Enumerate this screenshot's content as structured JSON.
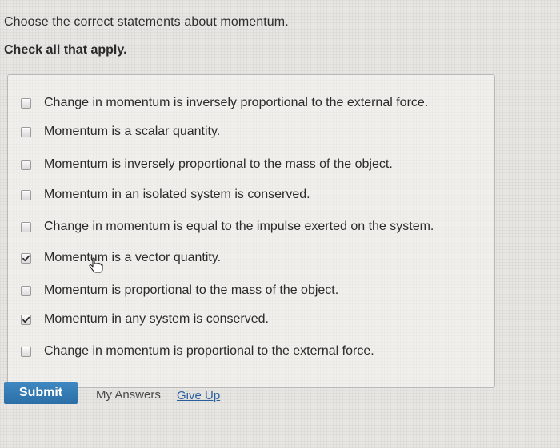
{
  "question": {
    "prompt": "Choose the correct statements about momentum.",
    "instruction": "Check all that apply."
  },
  "options": [
    {
      "label": "Change in momentum is inversely proportional to the external force.",
      "checked": false
    },
    {
      "label": "Momentum is a scalar quantity.",
      "checked": false
    },
    {
      "label": "Momentum is inversely proportional to the mass of the object.",
      "checked": false
    },
    {
      "label": "Momentum in an isolated system is conserved.",
      "checked": false
    },
    {
      "label": "Change in momentum is equal to the impulse exerted on the system.",
      "checked": false
    },
    {
      "label": "Momentum is a vector quantity.",
      "checked": true
    },
    {
      "label": "Momentum is proportional to the mass of the object.",
      "checked": false
    },
    {
      "label": "Momentum in any system is conserved.",
      "checked": true
    },
    {
      "label": "Change in momentum is proportional to the external force.",
      "checked": false
    }
  ],
  "actions": {
    "submit_label": "Submit",
    "my_answers_label": "My Answers",
    "give_up_label": "Give Up"
  },
  "colors": {
    "submit_button": "#3a7fb8",
    "link": "#2a5f9e",
    "check_mark": "#2b2b2b"
  },
  "icons": {
    "checkbox_checked": "check-mark-icon",
    "pointer": "hand-pointer-icon"
  }
}
